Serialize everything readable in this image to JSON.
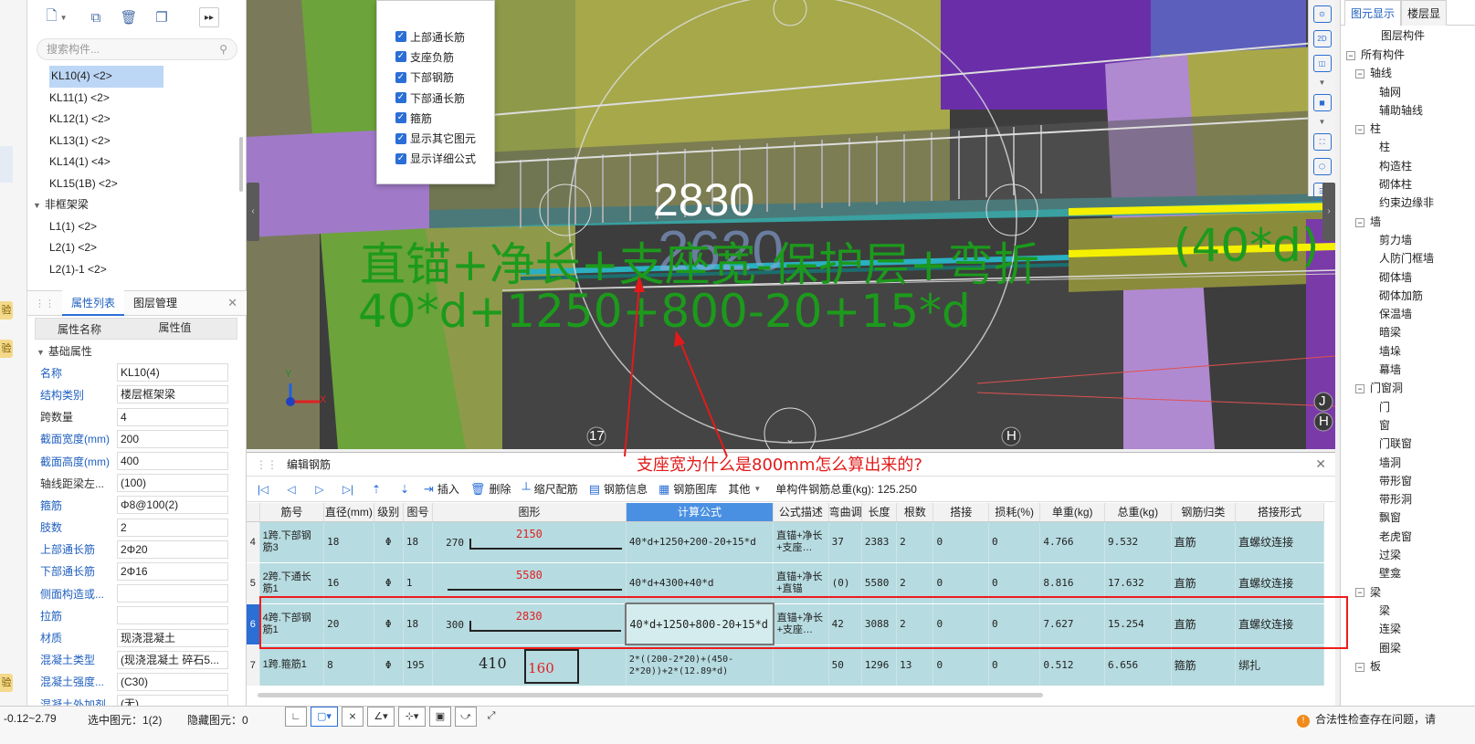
{
  "left_strip": {
    "tags": [
      "验",
      "验",
      "验"
    ]
  },
  "toolbar": {
    "more": "▸▸"
  },
  "search": {
    "placeholder": "搜索构件..."
  },
  "component_list": {
    "items": [
      "KL10(4) <2>",
      "KL11(1) <2>",
      "KL12(1) <2>",
      "KL13(1) <2>",
      "KL14(1) <4>",
      "KL15(1B) <2>"
    ],
    "group": "非框架梁",
    "group_items": [
      "L1(1) <2>",
      "L2(1) <2>",
      "L2(1)-1 <2>"
    ],
    "selected": "KL10(4) <2>"
  },
  "properties": {
    "tabs": [
      "属性列表",
      "图层管理"
    ],
    "col_name": "属性名称",
    "col_value": "属性值",
    "section": "基础属性",
    "rows": [
      {
        "name": "名称",
        "value": "KL10(4)"
      },
      {
        "name": "结构类别",
        "value": "楼层框架梁"
      },
      {
        "name": "跨数量",
        "value": "4"
      },
      {
        "name": "截面宽度(mm)",
        "value": "200"
      },
      {
        "name": "截面高度(mm)",
        "value": "400"
      },
      {
        "name": "轴线距梁左...",
        "value": "(100)"
      },
      {
        "name": "箍筋",
        "value": "Φ8@100(2)"
      },
      {
        "name": "肢数",
        "value": "2"
      },
      {
        "name": "上部通长筋",
        "value": "2Φ20"
      },
      {
        "name": "下部通长筋",
        "value": "2Φ16"
      },
      {
        "name": "侧面构造或...",
        "value": ""
      },
      {
        "name": "拉筋",
        "value": ""
      },
      {
        "name": "材质",
        "value": "现浇混凝土"
      },
      {
        "name": "混凝土类型",
        "value": "(现浇混凝土 碎石5..."
      },
      {
        "name": "混凝土强度...",
        "value": "(C30)"
      },
      {
        "name": "混凝土外加剂",
        "value": "(无)"
      }
    ]
  },
  "view3d": {
    "layer_checks": [
      "上部通长筋",
      "支座负筋",
      "下部钢筋",
      "下部通长筋",
      "箍筋",
      "显示其它图元",
      "显示详细公式"
    ],
    "length_label": "2830",
    "ghost_label": "2620",
    "formula_text": "直锚+净长+支座宽-保护层+弯折",
    "formula_values": "40*d+1250+800-20+15*d",
    "anchor_label": "(40*d)",
    "axis_labels": [
      "17",
      "H",
      "J",
      "H"
    ],
    "axis_y": "Y",
    "axis_x": "X"
  },
  "annotation": {
    "question": "支座宽为什么是800mm怎么算出来的?",
    "color": "#e21a1a"
  },
  "right_panel": {
    "tabs": [
      "图元显示",
      "楼层显"
    ],
    "heading": "图层构件",
    "tree": [
      {
        "label": "所有构件",
        "level": 0,
        "box": "−"
      },
      {
        "label": "轴线",
        "level": 1,
        "box": "−"
      },
      {
        "label": "轴网",
        "level": 2
      },
      {
        "label": "辅助轴线",
        "level": 2
      },
      {
        "label": "柱",
        "level": 1,
        "box": "−"
      },
      {
        "label": "柱",
        "level": 2
      },
      {
        "label": "构造柱",
        "level": 2
      },
      {
        "label": "砌体柱",
        "level": 2
      },
      {
        "label": "约束边缘非",
        "level": 2
      },
      {
        "label": "墙",
        "level": 1,
        "box": "−"
      },
      {
        "label": "剪力墙",
        "level": 2
      },
      {
        "label": "人防门框墙",
        "level": 2
      },
      {
        "label": "砌体墙",
        "level": 2
      },
      {
        "label": "砌体加筋",
        "level": 2
      },
      {
        "label": "保温墙",
        "level": 2
      },
      {
        "label": "暗梁",
        "level": 2
      },
      {
        "label": "墙垛",
        "level": 2
      },
      {
        "label": "幕墙",
        "level": 2
      },
      {
        "label": "门窗洞",
        "level": 1,
        "box": "−"
      },
      {
        "label": "门",
        "level": 2
      },
      {
        "label": "窗",
        "level": 2
      },
      {
        "label": "门联窗",
        "level": 2
      },
      {
        "label": "墙洞",
        "level": 2
      },
      {
        "label": "带形窗",
        "level": 2
      },
      {
        "label": "带形洞",
        "level": 2
      },
      {
        "label": "飘窗",
        "level": 2
      },
      {
        "label": "老虎窗",
        "level": 2
      },
      {
        "label": "过梁",
        "level": 2
      },
      {
        "label": "壁龛",
        "level": 2
      },
      {
        "label": "梁",
        "level": 1,
        "box": "−"
      },
      {
        "label": "梁",
        "level": 2
      },
      {
        "label": "连梁",
        "level": 2
      },
      {
        "label": "圈梁",
        "level": 2
      },
      {
        "label": "板",
        "level": 1,
        "box": "−"
      }
    ]
  },
  "rebar_editor": {
    "title": "编辑钢筋",
    "nav": [
      "|◁",
      "◁",
      "▷",
      "▷|"
    ],
    "tools": [
      {
        "icon": "insert-icon",
        "glyph": "⇥",
        "label": "插入"
      },
      {
        "icon": "delete-icon",
        "glyph": "🗑",
        "label": "删除"
      },
      {
        "icon": "scale-icon",
        "glyph": "┴",
        "label": "缩尺配筋"
      },
      {
        "icon": "info-icon",
        "glyph": "▤",
        "label": "钢筋信息"
      },
      {
        "icon": "library-icon",
        "glyph": "▦",
        "label": "钢筋图库"
      }
    ],
    "other_label": "其他",
    "weight_label": "单构件钢筋总重(kg): 125.250",
    "columns": [
      "筋号",
      "直径(mm)",
      "级别",
      "图号",
      "图形",
      "计算公式",
      "公式描述",
      "弯曲调整",
      "长度",
      "根数",
      "搭接",
      "损耗(%)",
      "单重(kg)",
      "总重(kg)",
      "钢筋归类",
      "搭接形式"
    ],
    "rows": [
      {
        "num": "4",
        "name": "1跨.下部钢筋3",
        "dia": "18",
        "grade": "Φ",
        "fig": "18",
        "shape_left": "270",
        "shape_val": "2150",
        "formula": "40*d+1250+200-20+15*d",
        "desc": "直锚+净长+支座…",
        "bend": "37",
        "len": "2383",
        "count": "2",
        "lap": "0",
        "loss": "0",
        "unit": "4.766",
        "total": "9.532",
        "type": "直筋",
        "lapform": "直螺纹连接"
      },
      {
        "num": "5",
        "name": "2跨.下通长筋1",
        "dia": "16",
        "grade": "Φ",
        "fig": "1",
        "shape_left": "",
        "shape_val": "5580",
        "formula": "40*d+4300+40*d",
        "desc": "直锚+净长+直锚",
        "bend": "(0)",
        "len": "5580",
        "count": "2",
        "lap": "0",
        "loss": "0",
        "unit": "8.816",
        "total": "17.632",
        "type": "直筋",
        "lapform": "直螺纹连接"
      },
      {
        "num": "6",
        "name": "4跨.下部钢筋1",
        "dia": "20",
        "grade": "Φ",
        "fig": "18",
        "shape_left": "300",
        "shape_val": "2830",
        "formula": "40*d+1250+800-20+15*d",
        "desc": "直锚+净长+支座…",
        "bend": "42",
        "len": "3088",
        "count": "2",
        "lap": "0",
        "loss": "0",
        "unit": "7.627",
        "total": "15.254",
        "type": "直筋",
        "lapform": "直螺纹连接"
      },
      {
        "num": "7",
        "name": "1跨.箍筋1",
        "dia": "8",
        "grade": "Φ",
        "fig": "195",
        "shape_left": "410",
        "shape_val": "160",
        "formula": "2*((200-2*20)+(450-2*20))+2*(12.89*d)",
        "desc": "",
        "bend": "50",
        "len": "1296",
        "count": "13",
        "lap": "0",
        "loss": "0",
        "unit": "0.512",
        "total": "6.656",
        "type": "箍筋",
        "lapform": "绑扎"
      }
    ]
  },
  "status_bar": {
    "range": "-0.12~2.79",
    "selected": "选中图元：1(2)",
    "hidden": "隐藏图元：0",
    "warning": "合法性检查存在问题，请"
  }
}
